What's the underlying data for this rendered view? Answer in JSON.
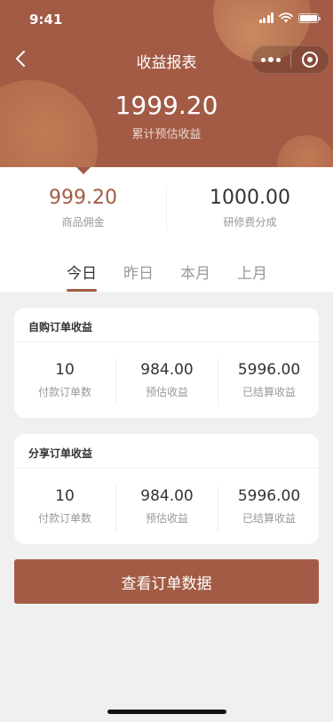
{
  "status_bar": {
    "time": "9:41"
  },
  "navbar": {
    "title": "收益报表"
  },
  "summary_header": {
    "total_amount": "1999.20",
    "total_label": "累计预估收益"
  },
  "summary": {
    "left": {
      "value": "999.20",
      "label": "商品佣金"
    },
    "right": {
      "value": "1000.00",
      "label": "研修费分成"
    }
  },
  "tabs": [
    {
      "label": "今日",
      "active": true
    },
    {
      "label": "昨日",
      "active": false
    },
    {
      "label": "本月",
      "active": false
    },
    {
      "label": "上月",
      "active": false
    }
  ],
  "cards": [
    {
      "title": "自购订单收益",
      "stats": [
        {
          "value": "10",
          "label": "付款订单数"
        },
        {
          "value": "984.00",
          "label": "预估收益"
        },
        {
          "value": "5996.00",
          "label": "已结算收益"
        }
      ]
    },
    {
      "title": "分享订单收益",
      "stats": [
        {
          "value": "10",
          "label": "付款订单数"
        },
        {
          "value": "984.00",
          "label": "预估收益"
        },
        {
          "value": "5996.00",
          "label": "已结算收益"
        }
      ]
    }
  ],
  "cta": {
    "label": "查看订单数据"
  },
  "colors": {
    "brand": "#a35b45",
    "background": "#f0f0f0"
  }
}
